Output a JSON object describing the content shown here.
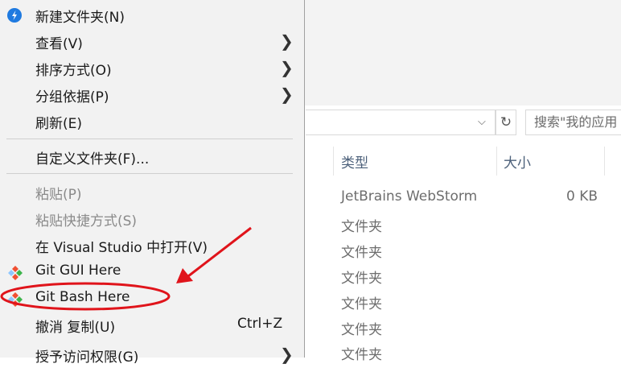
{
  "menu": {
    "items": [
      {
        "label": "新建文件夹(N)"
      },
      {
        "label": "查看(V)"
      },
      {
        "label": "排序方式(O)"
      },
      {
        "label": "分组依据(P)"
      },
      {
        "label": "刷新(E)"
      },
      {
        "label": "自定义文件夹(F)..."
      },
      {
        "label": "粘贴(P)"
      },
      {
        "label": "粘贴快捷方式(S)"
      },
      {
        "label": "在 Visual Studio 中打开(V)"
      },
      {
        "label": "Git GUI Here"
      },
      {
        "label": "Git Bash Here"
      },
      {
        "label": "撤消 复制(U)",
        "shortcut": "Ctrl+Z"
      },
      {
        "label": "授予访问权限(G)"
      }
    ]
  },
  "explorer": {
    "search_placeholder": "搜索\"我的应用",
    "columns": {
      "type": "类型",
      "size": "大小"
    },
    "rows": [
      {
        "type": "JetBrains WebStorm",
        "size": "0 KB"
      },
      {
        "type": "文件夹"
      },
      {
        "type": "文件夹"
      },
      {
        "type": "文件夹"
      },
      {
        "type": "文件夹"
      },
      {
        "type": "文件夹"
      },
      {
        "type": "文件夹"
      }
    ]
  },
  "colors": {
    "annotation_red": "#e0141b",
    "new_folder_icon": "#1f7ae0",
    "git_orange": "#f05033",
    "git_green": "#3cb44b"
  },
  "icons": {
    "new_folder": "new-folder-icon",
    "git_gui": "git-diamond-icon",
    "git_bash": "git-diamond-icon",
    "submenu": "chevron-right-icon",
    "refresh": "refresh-icon",
    "dropdown": "chevron-down-icon"
  }
}
